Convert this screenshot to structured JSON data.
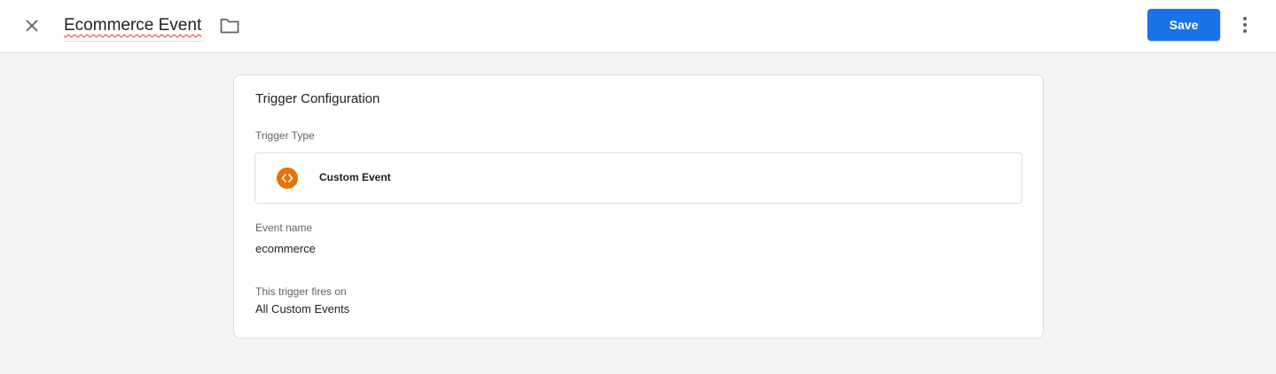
{
  "header": {
    "title": "Ecommerce Event",
    "save_label": "Save",
    "close_icon": "close-icon",
    "folder_icon": "folder-icon",
    "more_icon": "more-vert-icon",
    "accent_color": "#1a73e8"
  },
  "card": {
    "title": "Trigger Configuration",
    "trigger_type_label": "Trigger Type",
    "trigger_type": {
      "name": "Custom Event",
      "icon": "code-brackets-icon",
      "icon_color": "#e8710a"
    },
    "event_name_label": "Event name",
    "event_name_value": "ecommerce",
    "fires_on_label": "This trigger fires on",
    "fires_on_value": "All Custom Events"
  }
}
